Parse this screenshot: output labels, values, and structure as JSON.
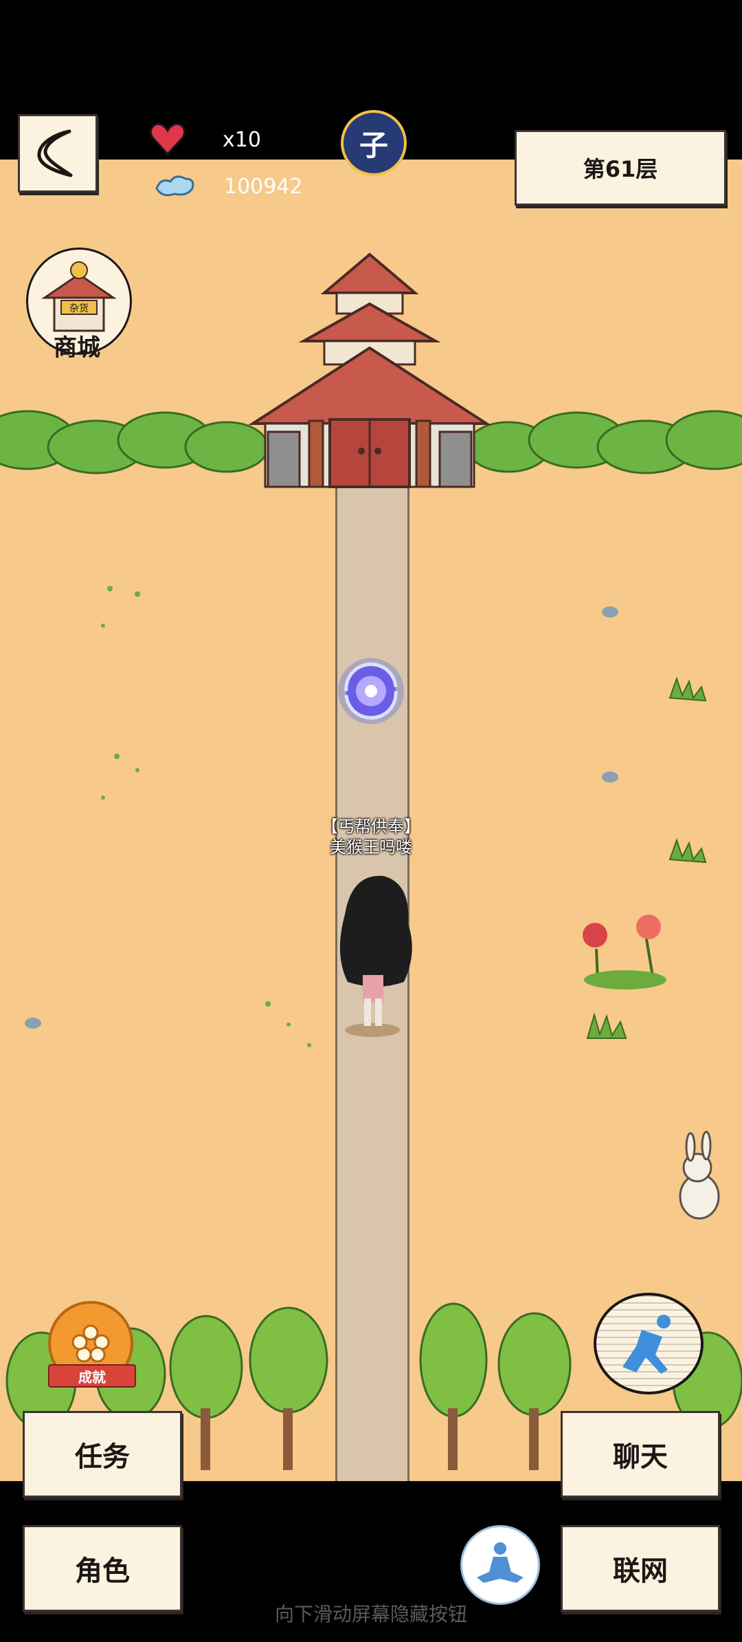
{
  "hud": {
    "lives": "x10",
    "currency": "100942",
    "floor": "第61层",
    "time_badge": "子"
  },
  "shop": {
    "label": "商城",
    "sign": "杂货"
  },
  "portal": {
    "icon": "swirl-portal-icon"
  },
  "character": {
    "title": "【丐帮供奉】",
    "name": "美猴王吗喽"
  },
  "achievement": {
    "label": "成就"
  },
  "buttons": {
    "task": "任务",
    "role": "角色",
    "chat": "聊天",
    "network": "联网"
  },
  "hint": "向下滑动屏幕隐藏按钮",
  "icons": {
    "back": "back-arrow-icon",
    "heart": "heart-icon",
    "cloud": "cloud-icon",
    "run": "run-icon",
    "meditate": "meditate-icon"
  },
  "colors": {
    "ground": "#f7c98a",
    "path": "#d9c5ab",
    "paper": "#fbf2df",
    "heart": "#e0384a"
  }
}
